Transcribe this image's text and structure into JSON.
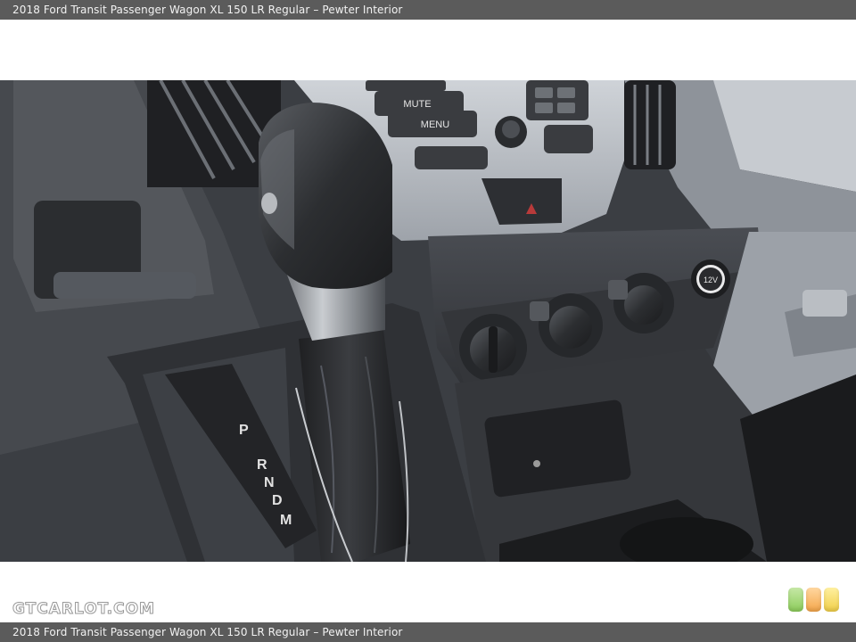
{
  "page": {
    "title": "2018 Ford Transit Passenger Wagon XL 150 LR Regular – Pewter Interior",
    "caption": "2018 Ford Transit Passenger Wagon XL 150 LR Regular – Pewter Interior",
    "site_logo": "GTCARLOT.COM"
  },
  "photo": {
    "radio_buttons": [
      "MUTE",
      "MENU"
    ],
    "gear_letters": [
      "P",
      "R",
      "N",
      "D",
      "M"
    ],
    "power_outlet_label": "12V"
  },
  "colors": {
    "bar": "#5b5b5b",
    "dash": "#3a3c40",
    "light_green": "#8ccc5a",
    "light_orange": "#f4a64a",
    "light_yellow": "#f1cf48"
  }
}
